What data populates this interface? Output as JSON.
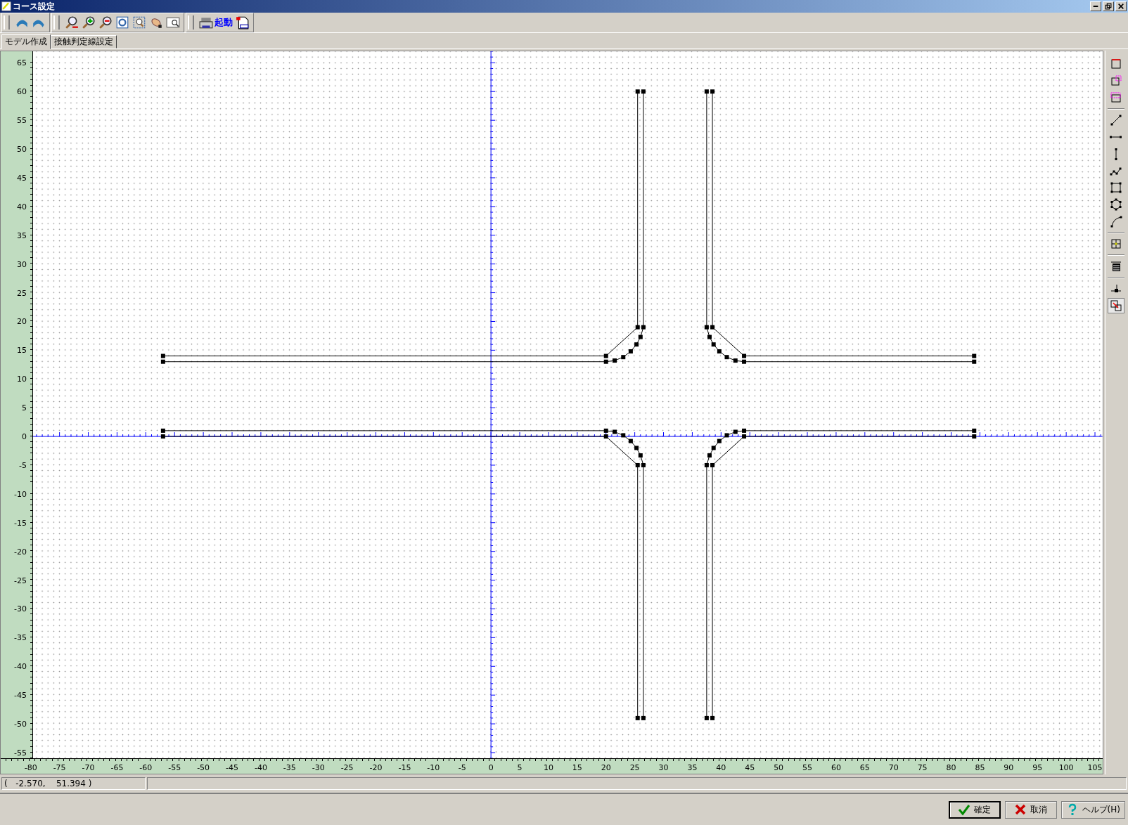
{
  "window": {
    "title": "コース設定"
  },
  "toolbar": {
    "launch_label": "起動"
  },
  "tabs": [
    {
      "label": "モデル作成",
      "selected": true
    },
    {
      "label": "接触判定線設定",
      "selected": false
    }
  ],
  "y_ruler": [
    "65",
    "60",
    "55",
    "50",
    "45",
    "40",
    "35",
    "30",
    "25",
    "20",
    "15",
    "10",
    "5",
    "0",
    "-5",
    "-10",
    "-15",
    "-20",
    "-25",
    "-30",
    "-35",
    "-40",
    "-45",
    "-50",
    "-55"
  ],
  "x_ruler": [
    "-80",
    "-75",
    "-70",
    "-65",
    "-60",
    "-55",
    "-50",
    "-45",
    "-40",
    "-35",
    "-30",
    "-25",
    "-20",
    "-15",
    "-10",
    "-5",
    "0",
    "5",
    "10",
    "15",
    "20",
    "25",
    "30",
    "35",
    "40",
    "45",
    "50",
    "55",
    "60",
    "65",
    "70",
    "75",
    "80",
    "85",
    "90",
    "95",
    "100",
    "105"
  ],
  "status_bar": {
    "coordinates": "(   -2.570,    51.394 )"
  },
  "buttons": [
    {
      "kind": "ok",
      "label": "確定",
      "default": true
    },
    {
      "kind": "cancel",
      "label": "取消",
      "default": false
    },
    {
      "kind": "help",
      "label": "ヘルプ(H)",
      "default": false
    }
  ]
}
